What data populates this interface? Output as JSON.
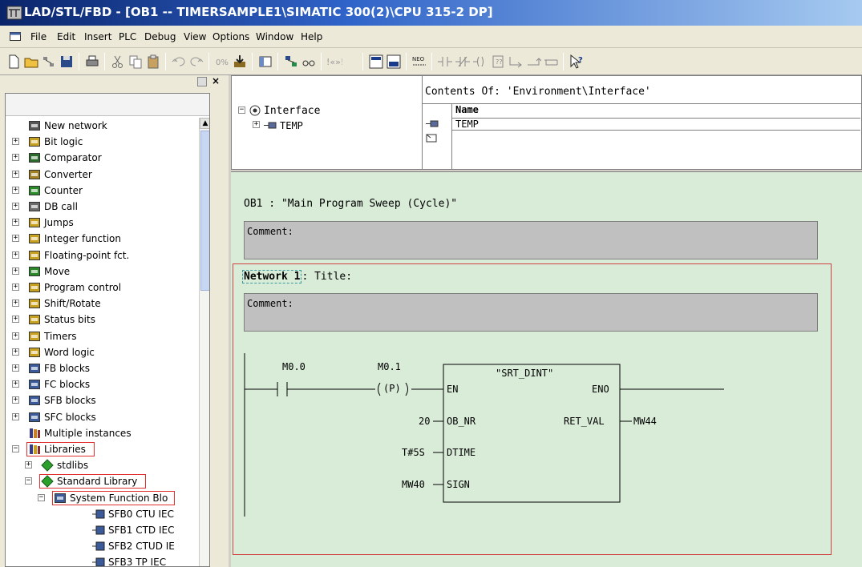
{
  "window": {
    "title": "LAD/STL/FBD  - [OB1 -- TIMERSAMPLE1\\SIMATIC 300(2)\\CPU 315-2 DP]"
  },
  "menu": [
    "File",
    "Edit",
    "Insert",
    "PLC",
    "Debug",
    "View",
    "Options",
    "Window",
    "Help"
  ],
  "toolbar": {
    "icons": [
      "new-icon",
      "open-icon",
      "network-icon",
      "save-icon",
      "print-icon",
      "cut-icon",
      "copy-icon",
      "paste-icon",
      "undo-icon",
      "redo-icon",
      "monitor-icon",
      "download-icon",
      "overview-icon",
      "program-elements-icon",
      "glasses-icon",
      "prev-next-icon",
      "lad-view-icon",
      "details-icon",
      "new-network-icon",
      "no-contact-icon",
      "nc-contact-icon",
      "coil-icon",
      "empty-box-icon",
      "branch-open-icon",
      "branch-close-icon",
      "help-icon"
    ]
  },
  "tree": {
    "items": [
      {
        "label": "New network",
        "icon": "network-icon",
        "expander": "",
        "level": 0
      },
      {
        "label": "Bit logic",
        "icon": "bit-logic-icon",
        "expander": "+",
        "level": 0
      },
      {
        "label": "Comparator",
        "icon": "comparator-icon",
        "expander": "+",
        "level": 0
      },
      {
        "label": "Converter",
        "icon": "converter-icon",
        "expander": "+",
        "level": 0
      },
      {
        "label": "Counter",
        "icon": "counter-icon",
        "expander": "+",
        "level": 0
      },
      {
        "label": "DB call",
        "icon": "db-icon",
        "expander": "+",
        "level": 0
      },
      {
        "label": "Jumps",
        "icon": "jumps-icon",
        "expander": "+",
        "level": 0
      },
      {
        "label": "Integer function",
        "icon": "integer-icon",
        "expander": "+",
        "level": 0
      },
      {
        "label": "Floating-point fct.",
        "icon": "float-icon",
        "expander": "+",
        "level": 0
      },
      {
        "label": "Move",
        "icon": "move-icon",
        "expander": "+",
        "level": 0
      },
      {
        "label": "Program control",
        "icon": "program-control-icon",
        "expander": "+",
        "level": 0
      },
      {
        "label": "Shift/Rotate",
        "icon": "shift-icon",
        "expander": "+",
        "level": 0
      },
      {
        "label": "Status bits",
        "icon": "status-icon",
        "expander": "+",
        "level": 0
      },
      {
        "label": "Timers",
        "icon": "timer-icon",
        "expander": "+",
        "level": 0
      },
      {
        "label": "Word logic",
        "icon": "word-logic-icon",
        "expander": "+",
        "level": 0
      },
      {
        "label": "FB blocks",
        "icon": "block-icon",
        "expander": "+",
        "level": 0
      },
      {
        "label": "FC blocks",
        "icon": "block-icon",
        "expander": "+",
        "level": 0
      },
      {
        "label": "SFB blocks",
        "icon": "block-icon",
        "expander": "+",
        "level": 0
      },
      {
        "label": "SFC blocks",
        "icon": "block-icon",
        "expander": "+",
        "level": 0
      },
      {
        "label": "Multiple instances",
        "icon": "instances-icon",
        "expander": "",
        "level": 0
      },
      {
        "label": "Libraries",
        "icon": "libraries-icon",
        "expander": "−",
        "level": 0
      },
      {
        "label": "stdlibs",
        "icon": "library-icon",
        "expander": "+",
        "level": 1
      },
      {
        "label": "Standard Library",
        "icon": "library-icon",
        "expander": "−",
        "level": 1
      },
      {
        "label": "System Function Blo",
        "icon": "block-icon",
        "expander": "−",
        "level": 2
      },
      {
        "label": "SFB0  CTU  IEC",
        "icon": "function-block-icon",
        "expander": "",
        "level": 3
      },
      {
        "label": "SFB1  CTD  IEC",
        "icon": "function-block-icon",
        "expander": "",
        "level": 3
      },
      {
        "label": "SFB2  CTUD  IE",
        "icon": "function-block-icon",
        "expander": "",
        "level": 3
      },
      {
        "label": "SFB3  TP  IEC",
        "icon": "function-block-icon",
        "expander": "",
        "level": 3
      }
    ]
  },
  "interface": {
    "root": "Interface",
    "child": "TEMP",
    "contents_label": "Contents Of: 'Environment\\Interface'",
    "name_header": "Name",
    "row": "TEMP"
  },
  "editor": {
    "ob_title": "OB1 :  \"Main Program Sweep (Cycle)\"",
    "comment1": "Comment:",
    "network_label": "Network 1",
    "network_title": ": Title:",
    "comment2": "Comment:",
    "contact1": "M0.0",
    "contact2": "M0.1",
    "coil_p": "(P)",
    "block_name": "\"SRT_DINT\"",
    "pin_en": "EN",
    "pin_eno": "ENO",
    "pin_ob_nr": "OB_NR",
    "pin_ret_val": "RET_VAL",
    "pin_dtime": "DTIME",
    "pin_sign": "SIGN",
    "val_ob_nr": "20",
    "val_ret_val": "MW44",
    "val_dtime": "T#5S",
    "val_sign": "MW40"
  },
  "colors": {
    "editor_bg": "#d8ecd8",
    "highlight_red": "#e03030",
    "title_bar": "#0a246a"
  }
}
